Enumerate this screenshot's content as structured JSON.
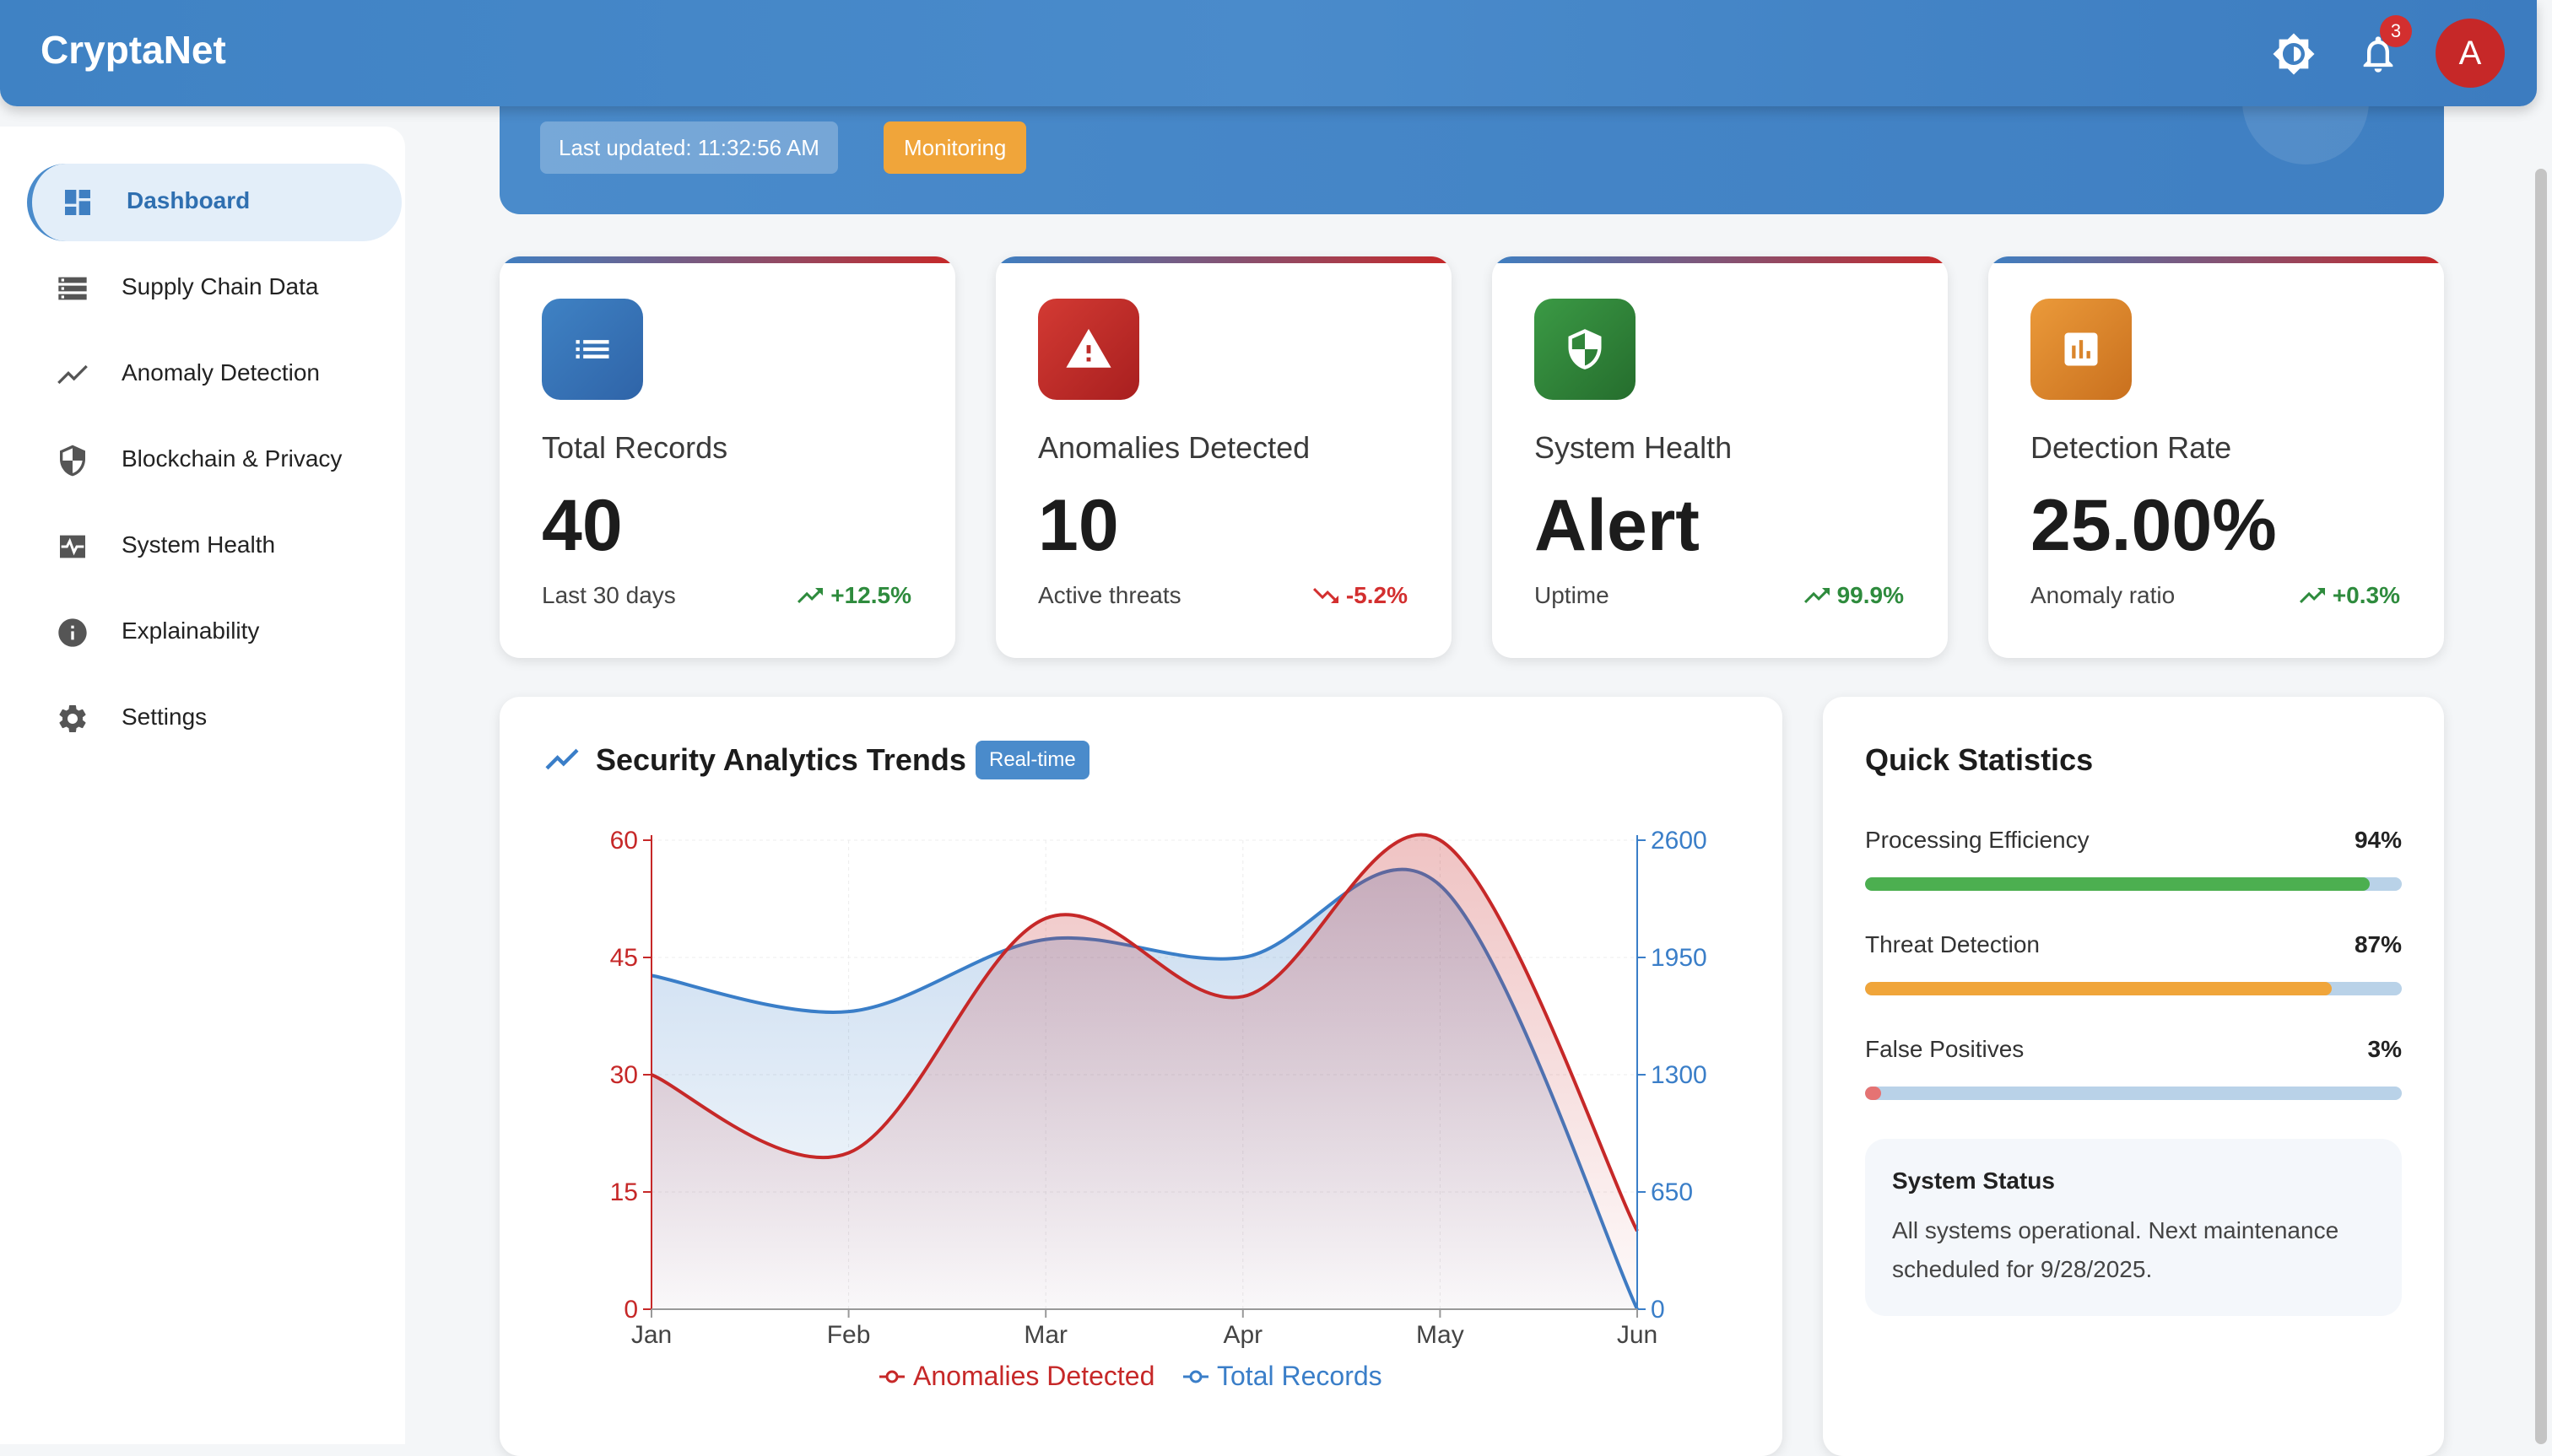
{
  "app": {
    "title": "CryptaNet",
    "notification_count": "3",
    "avatar_letter": "A"
  },
  "sidebar": {
    "items": [
      {
        "label": "Dashboard",
        "icon": "dashboard-icon"
      },
      {
        "label": "Supply Chain Data",
        "icon": "list-icon"
      },
      {
        "label": "Anomaly Detection",
        "icon": "trend-icon"
      },
      {
        "label": "Blockchain & Privacy",
        "icon": "shield-icon"
      },
      {
        "label": "System Health",
        "icon": "heartbeat-icon"
      },
      {
        "label": "Explainability",
        "icon": "info-icon"
      },
      {
        "label": "Settings",
        "icon": "gear-icon"
      }
    ]
  },
  "hero": {
    "last_updated": "Last updated: 11:32:56 AM",
    "status_chip": "Monitoring"
  },
  "cards": [
    {
      "title": "Total Records",
      "value": "40",
      "sub": "Last 30 days",
      "trend": "+12.5%",
      "direction": "up",
      "icon": "list-icon",
      "color": "#2f6fb0"
    },
    {
      "title": "Anomalies Detected",
      "value": "10",
      "sub": "Active threats",
      "trend": "-5.2%",
      "direction": "down",
      "icon": "warning-icon",
      "color": "#c62828"
    },
    {
      "title": "System Health",
      "value": "Alert",
      "sub": "Uptime",
      "trend": "99.9%",
      "direction": "up",
      "icon": "shield-icon",
      "color": "#2e7d32"
    },
    {
      "title": "Detection Rate",
      "value": "25.00%",
      "sub": "Anomaly ratio",
      "trend": "+0.3%",
      "direction": "up",
      "icon": "bar-chart-icon",
      "color": "#d9822b"
    }
  ],
  "chart_panel": {
    "title": "Security Analytics Trends",
    "badge": "Real-time"
  },
  "chart_data": {
    "type": "area",
    "categories": [
      "Jan",
      "Feb",
      "Mar",
      "Apr",
      "May",
      "Jun"
    ],
    "series": [
      {
        "name": "Anomalies Detected",
        "axis": "left",
        "color": "#c62828",
        "values": [
          30,
          20,
          50,
          40,
          60,
          10
        ]
      },
      {
        "name": "Total Records",
        "axis": "right",
        "color": "#3a7ec8",
        "values": [
          1850,
          1650,
          2050,
          1950,
          2350,
          0
        ]
      }
    ],
    "y_left": {
      "min": 0,
      "max": 60,
      "ticks": [
        0,
        15,
        30,
        45,
        60
      ]
    },
    "y_right": {
      "min": 0,
      "max": 2600,
      "ticks": [
        0,
        650,
        1300,
        1950,
        2600
      ]
    },
    "grid": true,
    "legend": "bottom"
  },
  "quick_stats": {
    "title": "Quick Statistics",
    "rows": [
      {
        "label": "Processing Efficiency",
        "value": "94%",
        "fraction": 0.94,
        "color": "#4caf50"
      },
      {
        "label": "Threat Detection",
        "value": "87%",
        "fraction": 0.87,
        "color": "#f0a53a"
      },
      {
        "label": "False Positives",
        "value": "3%",
        "fraction": 0.03,
        "color": "#e57373"
      }
    ],
    "status_title": "System Status",
    "status_text": "All systems operational. Next maintenance scheduled for 9/28/2025."
  }
}
